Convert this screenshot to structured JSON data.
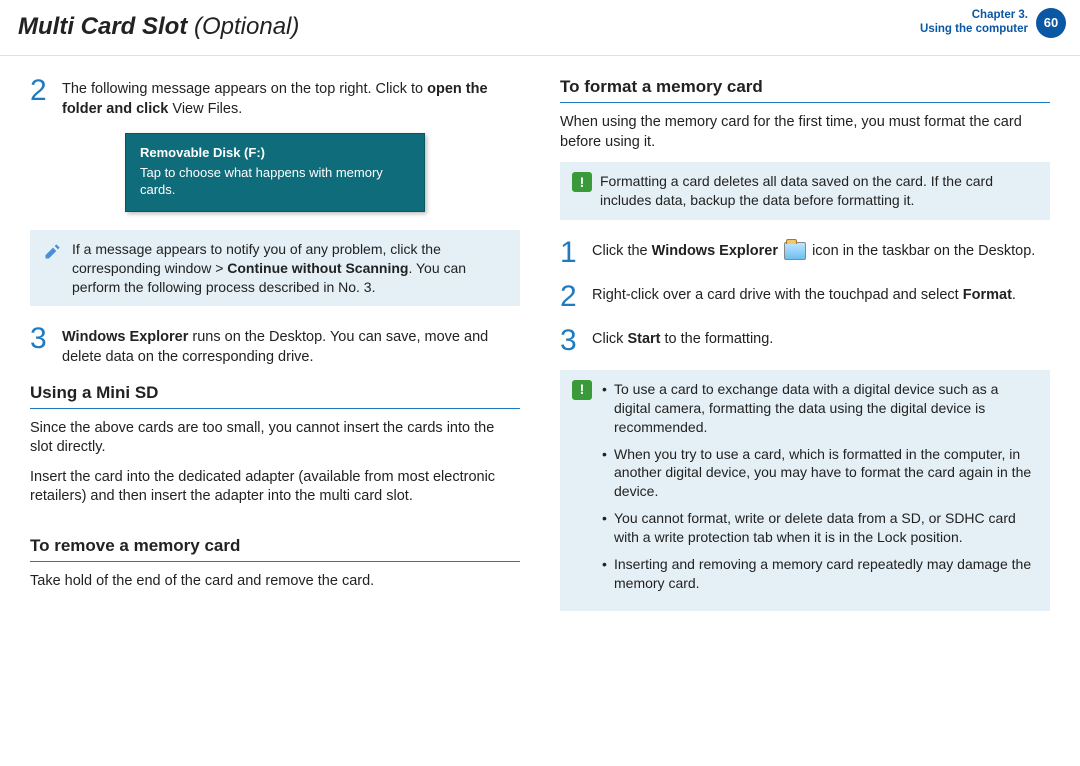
{
  "header": {
    "title_main": "Multi Card Slot",
    "title_optional": " (Optional)",
    "chapter_line1": "Chapter 3.",
    "chapter_line2": "Using the computer",
    "page_num": "60"
  },
  "left": {
    "step2_pre": "The following message appears on the top right. Click to ",
    "step2_bold": "open the folder and click",
    "step2_post": " View Files.",
    "toast_title": "Removable Disk (F:)",
    "toast_body": "Tap to choose what happens with memory cards.",
    "note1_pre": "If a message appears to notify you of any problem, click the corresponding window > ",
    "note1_bold": "Continue without Scanning",
    "note1_post": ". You can perform the following process described in No. 3.",
    "step3_bold": "Windows Explorer",
    "step3_post": " runs on the Desktop. You can save, move and delete data on the corresponding drive.",
    "h_minisd": "Using a Mini SD",
    "minisd_p1": "Since the above cards are too small, you cannot insert the cards into the slot directly.",
    "minisd_p2": "Insert the card into the dedicated adapter (available from most electronic retailers) and then insert the adapter into the multi card slot.",
    "h_remove": "To remove a memory card",
    "remove_p": "Take hold of the end of the card and remove the card."
  },
  "right": {
    "h_format": "To format a memory card",
    "format_intro": "When using the memory card for the first time, you must format the card before using it.",
    "warn1": "Formatting a card deletes all data saved on the card. If the card includes data, backup the data before formatting it.",
    "step1_pre": "Click the ",
    "step1_bold": "Windows Explorer",
    "step1_post": " icon in the taskbar on the Desktop.",
    "step2_pre": "Right-click over a card drive with the touchpad and select ",
    "step2_bold": "Format",
    "step2_post": ".",
    "step3_pre": "Click ",
    "step3_bold": "Start",
    "step3_post": " to the formatting.",
    "warn2_items": [
      "To use a card to exchange data with a digital device such as a digital camera, formatting the data using the digital device is recommended.",
      "When you try to use a card, which is formatted in the computer, in another digital device, you may have to format the card again in the device.",
      "You cannot format, write or delete data from a SD, or SDHC card with a write protection tab when it is in the Lock position.",
      "Inserting and removing a memory card repeatedly may damage the memory card."
    ]
  },
  "nums": {
    "n1": "1",
    "n2": "2",
    "n3": "3"
  }
}
